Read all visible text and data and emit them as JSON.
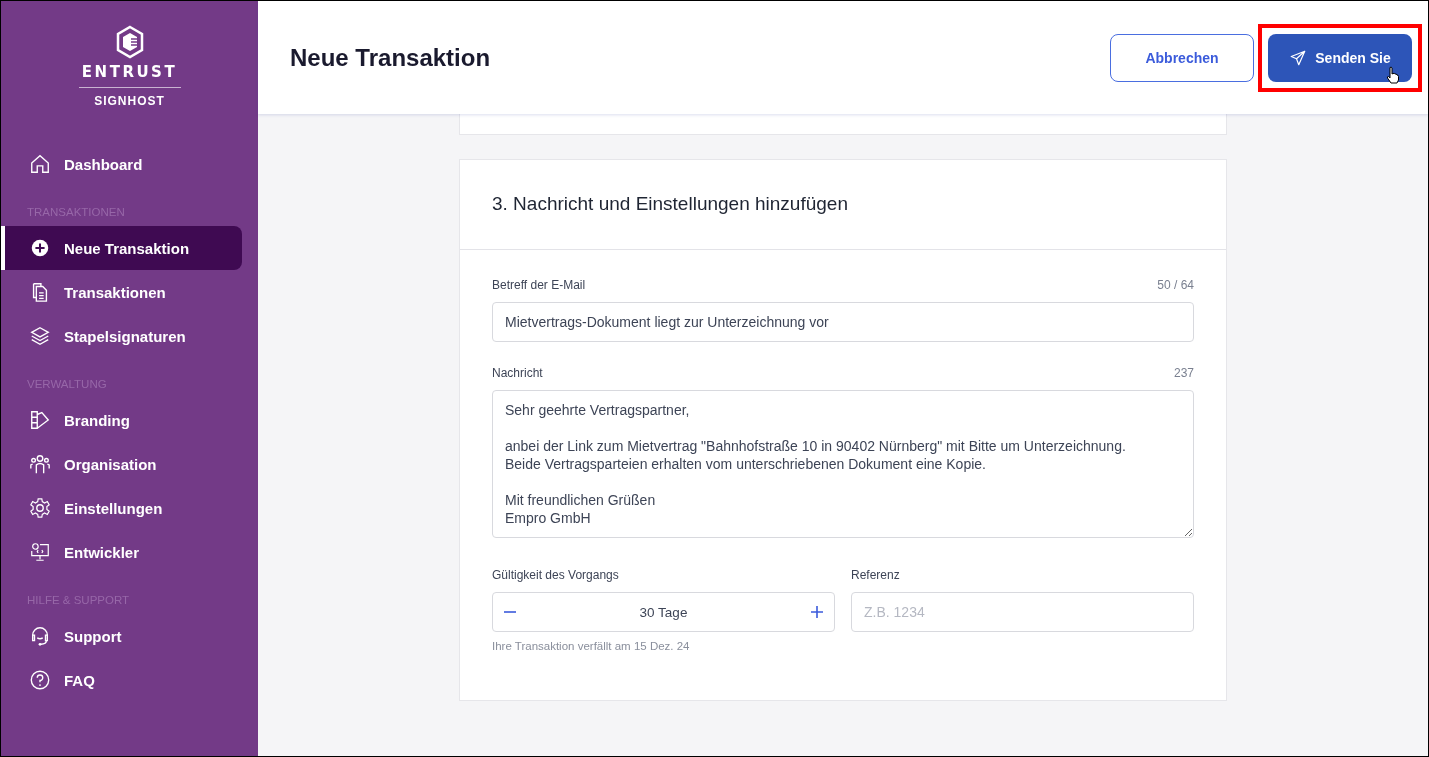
{
  "logo": {
    "brand": "ENTRUST",
    "product": "SIGNHOST"
  },
  "sidebar": {
    "sections": [
      {
        "items": [
          {
            "label": "Dashboard",
            "selected": false
          }
        ]
      },
      {
        "heading": "TRANSAKTIONEN",
        "items": [
          {
            "label": "Neue Transaktion",
            "selected": true
          },
          {
            "label": "Transaktionen",
            "selected": false
          },
          {
            "label": "Stapelsignaturen",
            "selected": false
          }
        ]
      },
      {
        "heading": "VERWALTUNG",
        "items": [
          {
            "label": "Branding",
            "selected": false
          },
          {
            "label": "Organisation",
            "selected": false
          },
          {
            "label": "Einstellungen",
            "selected": false
          },
          {
            "label": "Entwickler",
            "selected": false
          }
        ]
      },
      {
        "heading": "HILFE & SUPPORT",
        "items": [
          {
            "label": "Support",
            "selected": false
          },
          {
            "label": "FAQ",
            "selected": false
          }
        ]
      }
    ]
  },
  "header": {
    "title": "Neue Transaktion",
    "cancel_button": "Abbrechen",
    "send_button": "Senden Sie",
    "send_highlighted": true
  },
  "card": {
    "title": "3. Nachricht und Einstellungen hinzufügen",
    "subject": {
      "label": "Betreff der E-Mail",
      "counter": "50 / 64",
      "value": "Mietvertrags-Dokument liegt zur Unterzeichnung vor"
    },
    "message": {
      "label": "Nachricht",
      "counter": "237",
      "value": "Sehr geehrte Vertragspartner,\n\nanbei der Link zum Mietvertrag \"Bahnhofstraße 10 in 90402 Nürnberg\" mit Bitte um Unterzeichnung.\nBeide Vertragsparteien erhalten vom unterschriebenen Dokument eine Kopie.\n\nMit freundlichen Grüßen\nEmpro GmbH"
    },
    "validity": {
      "label": "Gültigkeit des Vorgangs",
      "value": "30 Tage",
      "hint": "Ihre Transaktion verfällt am 15 Dez. 24"
    },
    "reference": {
      "label": "Referenz",
      "placeholder": "Z.B. 1234"
    }
  }
}
